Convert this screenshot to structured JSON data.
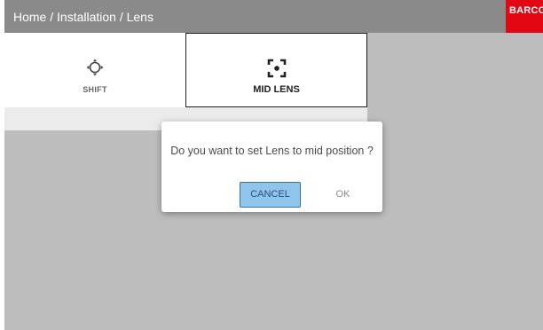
{
  "header": {
    "breadcrumb": "Home / Installation / Lens",
    "logo_text": "BARCO",
    "logo_color": "#e30613"
  },
  "tiles": [
    {
      "label": "SHIFT",
      "icon": "shift-icon",
      "selected": false
    },
    {
      "label": "MID LENS",
      "icon": "mid-lens-icon",
      "selected": true
    }
  ],
  "dialog": {
    "message": "Do you want to set Lens to mid position ?",
    "cancel_label": "CANCEL",
    "ok_label": "OK",
    "cancel_color": "#8fc4ec"
  }
}
